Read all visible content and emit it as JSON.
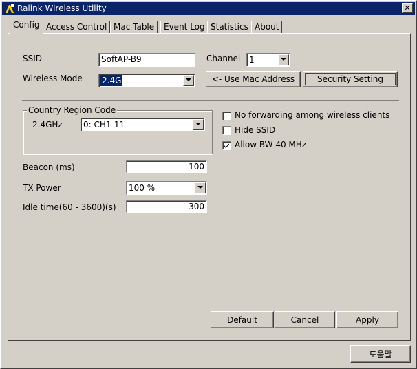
{
  "window": {
    "title": "Ralink Wireless Utility",
    "close_label": "✕"
  },
  "tabs": [
    {
      "label": "Config"
    },
    {
      "label": "Access Control"
    },
    {
      "label": "Mac Table"
    },
    {
      "label": "Event Log"
    },
    {
      "label": "Statistics"
    },
    {
      "label": "About"
    }
  ],
  "config": {
    "ssid_label": "SSID",
    "ssid_value": "SoftAP-B9",
    "channel_label": "Channel",
    "channel_value": "1",
    "wireless_mode_label": "Wireless Mode",
    "wireless_mode_value": "2.4G",
    "use_mac_button": "<- Use Mac Address",
    "security_button": "Security Setting",
    "country_group_title": "Country Region Code",
    "band_label": "2.4GHz",
    "region_value": "0: CH1-11",
    "no_forwarding_label": "No forwarding among wireless clients",
    "no_forwarding_checked": false,
    "hide_ssid_label": "Hide SSID",
    "hide_ssid_checked": false,
    "allow_bw_label": "Allow BW 40 MHz",
    "allow_bw_checked": true,
    "beacon_label": "Beacon (ms)",
    "beacon_value": "100",
    "tx_power_label": "TX Power",
    "tx_power_value": "100 %",
    "idle_label": "Idle time(60 - 3600)(s)",
    "idle_value": "300",
    "default_button": "Default",
    "cancel_button": "Cancel",
    "apply_button": "Apply"
  },
  "footer": {
    "help_button": "도움말"
  },
  "colors": {
    "titlebar": "#0a246a",
    "face": "#d4d0c8",
    "focus_border": "#e00000"
  }
}
